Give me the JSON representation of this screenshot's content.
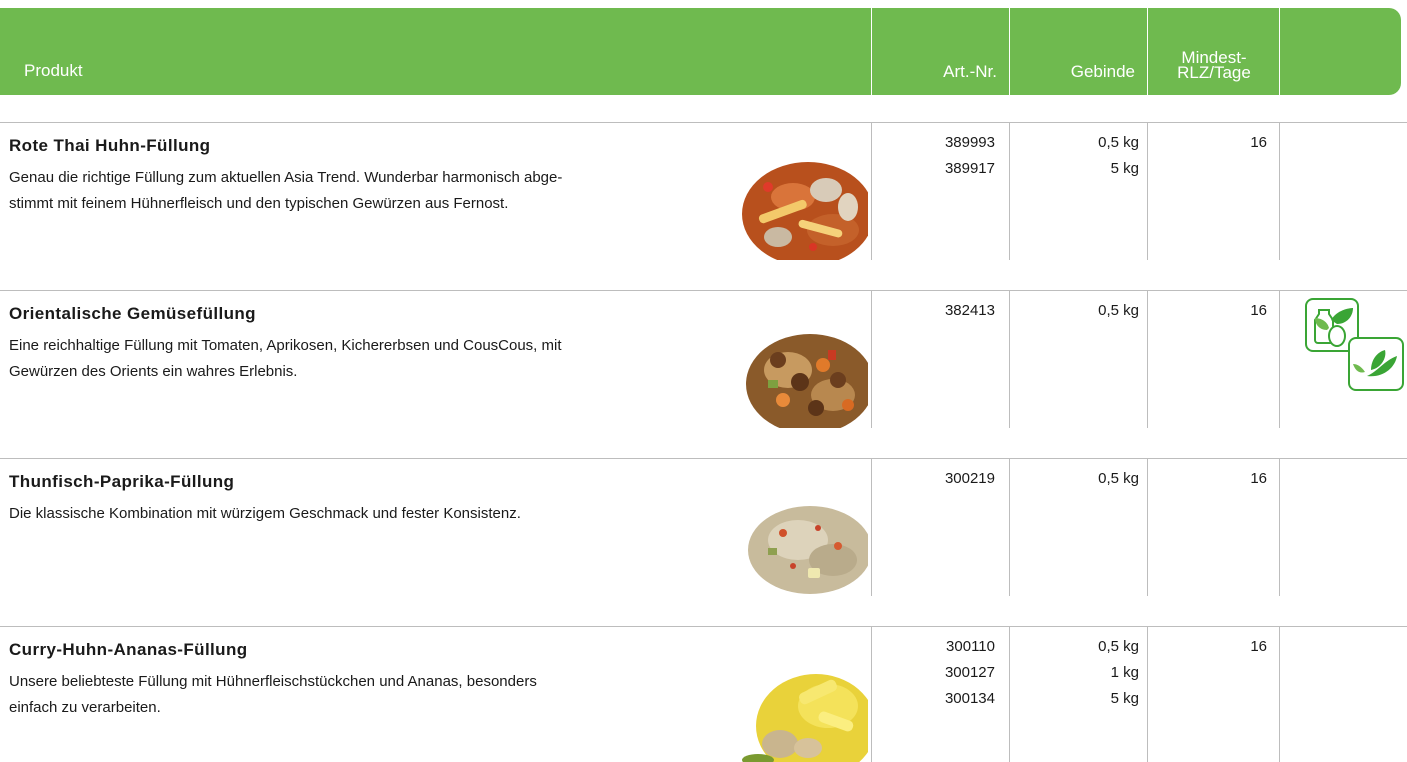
{
  "header": {
    "produkt": "Produkt",
    "art_nr": "Art.-Nr.",
    "gebinde": "Gebinde",
    "rlz_line1": "Mindest-",
    "rlz_line2": "RLZ/Tage"
  },
  "rows": [
    {
      "title": "Rote Thai Huhn-Füllung",
      "desc_line1": "Genau die richtige Füllung zum aktuellen Asia Trend. Wunderbar harmonisch abge-",
      "desc_line2": "stimmt mit feinem Hühnerfleisch und den typischen Gewürzen aus Fernost.",
      "art": [
        "389993",
        "389917"
      ],
      "gebinde": [
        "0,5 kg",
        "5 kg"
      ],
      "rlz": "16",
      "photo_icon": "red-thai-chicken-photo"
    },
    {
      "title": "Orientalische Gemüsefüllung",
      "desc_line1": "Eine reichhaltige Füllung mit Tomaten, Aprikosen, Kichererbsen und CousCous, mit",
      "desc_line2": "Gewürzen des Orients ein wahres Erlebnis.",
      "art": [
        "382413"
      ],
      "gebinde": [
        "0,5 kg"
      ],
      "rlz": "16",
      "photo_icon": "oriental-vegetable-photo",
      "badges": [
        "vegetarian-milk-egg-icon",
        "vegan-leaf-icon"
      ]
    },
    {
      "title": "Thunfisch-Paprika-Füllung",
      "desc_line1": "Die klassische Kombination mit würzigem Geschmack und fester Konsistenz.",
      "art": [
        "300219"
      ],
      "gebinde": [
        "0,5 kg"
      ],
      "rlz": "16",
      "photo_icon": "tuna-pepper-photo"
    },
    {
      "title": "Curry-Huhn-Ananas-Füllung",
      "desc_line1": "Unsere beliebteste Füllung mit Hühnerfleischstückchen und Ananas, besonders",
      "desc_line2": "einfach zu verarbeiten.",
      "art": [
        "300110",
        "300127",
        "300134"
      ],
      "gebinde": [
        "0,5 kg",
        "1 kg",
        "5 kg"
      ],
      "rlz": "16",
      "photo_icon": "curry-chicken-pineapple-photo"
    }
  ],
  "colors": {
    "header_green": "#6fba4f",
    "badge_green": "#3aa535",
    "line_gray": "#bdbdbd"
  }
}
